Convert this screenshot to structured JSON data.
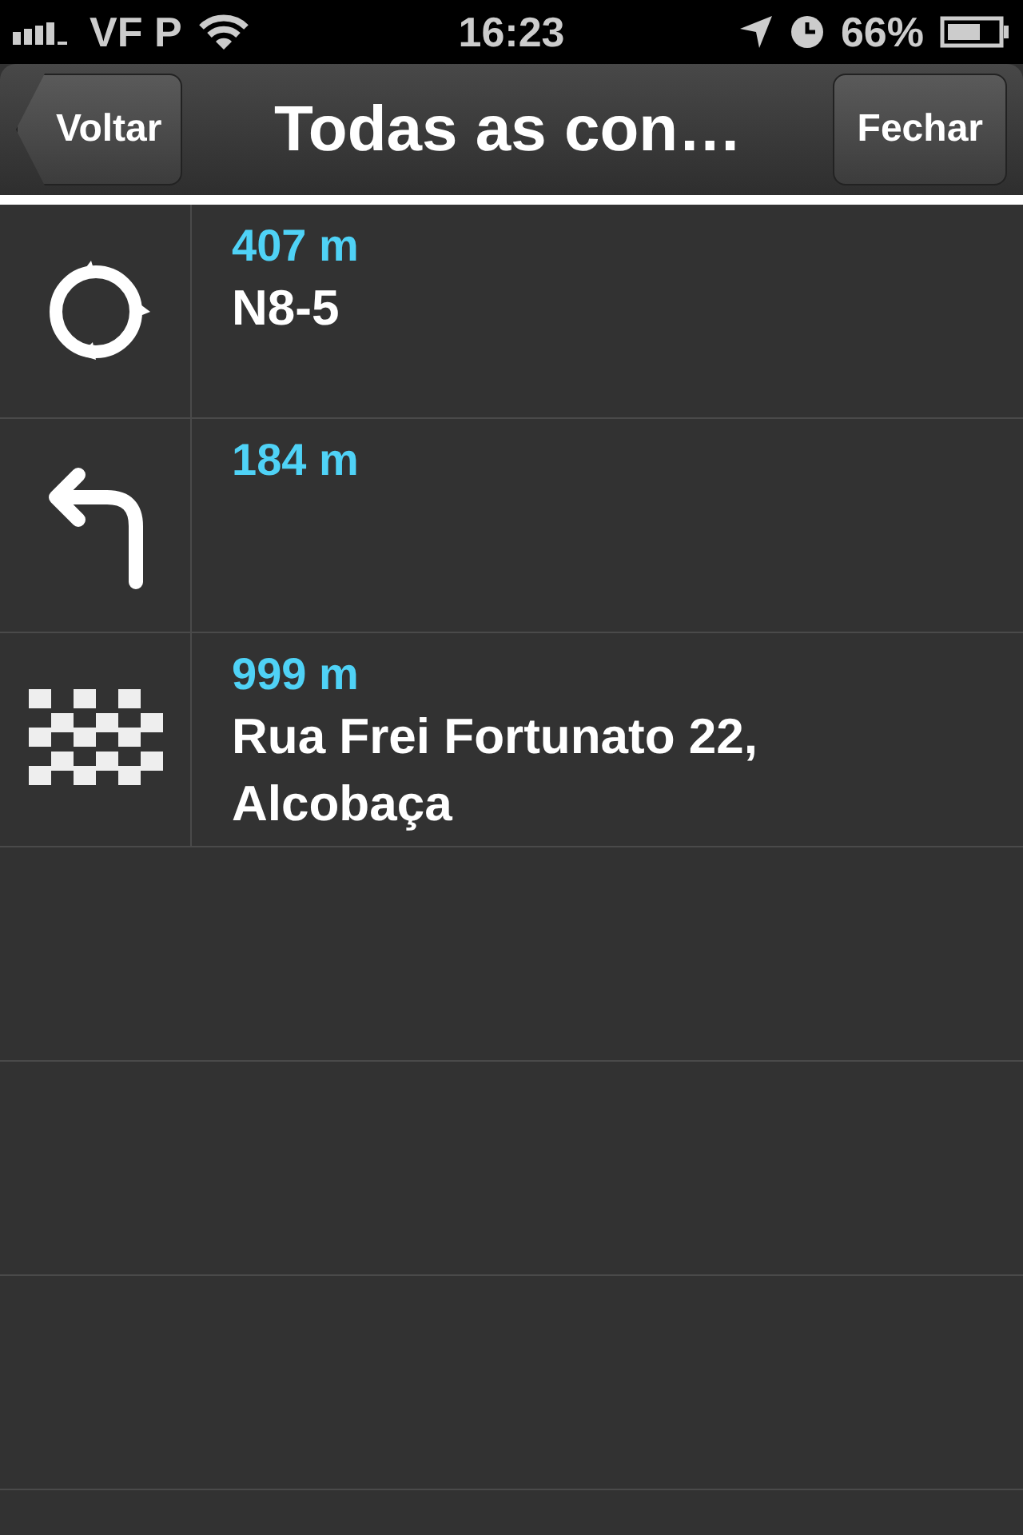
{
  "status_bar": {
    "carrier": "VF P",
    "time": "16:23",
    "battery": "66%"
  },
  "nav_bar": {
    "back": "Voltar",
    "title": "Todas as con…",
    "close": "Fechar"
  },
  "instructions": [
    {
      "kind": "roundabout",
      "distance": "407 m",
      "road": "N8-5"
    },
    {
      "kind": "turn-left",
      "distance": "184 m"
    },
    {
      "kind": "finish",
      "distance": "999 m",
      "road": "Rua Frei Fortunato 22, Alcobaça"
    }
  ]
}
